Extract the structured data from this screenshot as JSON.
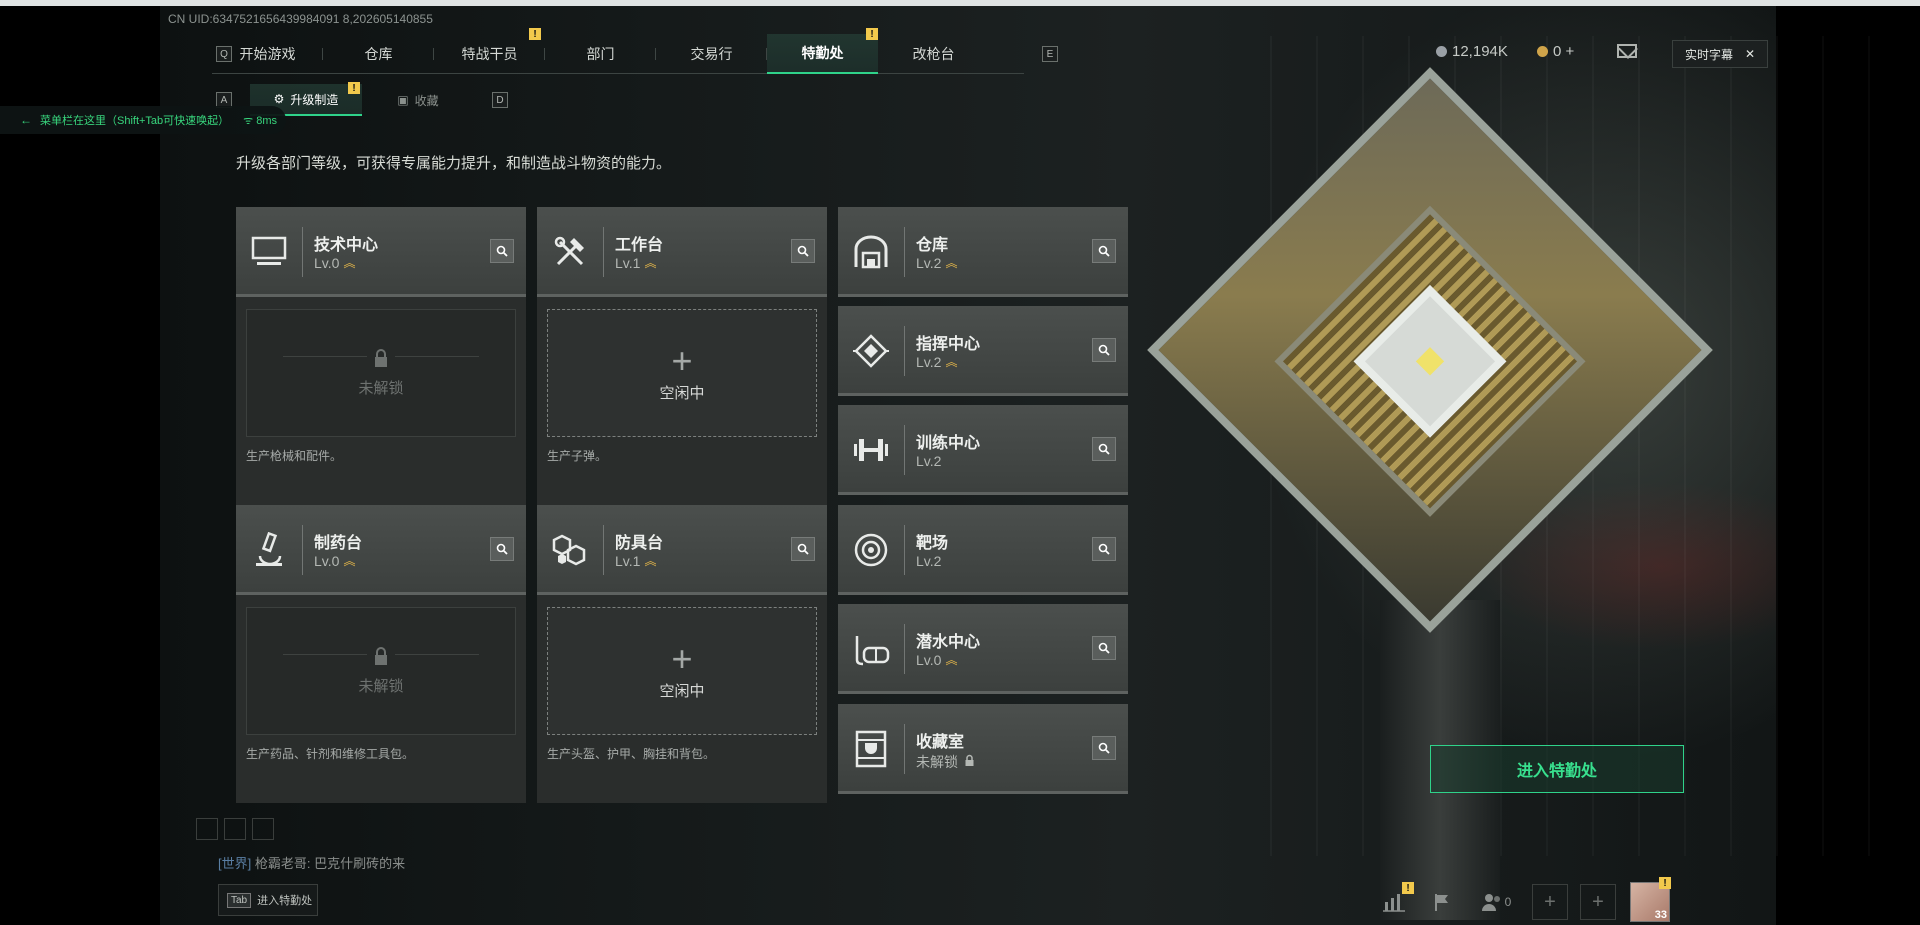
{
  "uid_text": "CN UID:6347521656439984091 8,202605140855",
  "top_nav": {
    "key_left": "Q",
    "key_right": "E",
    "tabs": [
      {
        "label": "开始游戏"
      },
      {
        "label": "仓库"
      },
      {
        "label": "特战干员",
        "badge": "!"
      },
      {
        "label": "部门"
      },
      {
        "label": "交易行"
      },
      {
        "label": "特勤处",
        "badge": "!",
        "active": true
      },
      {
        "label": "改枪台"
      }
    ]
  },
  "sub_nav": {
    "key_left": "A",
    "key_right": "D",
    "tabs": [
      {
        "label": "升级制造",
        "badge": "!",
        "active": true
      },
      {
        "label": "收藏"
      }
    ]
  },
  "overlay_notice": {
    "text": "菜单栏在这里（Shift+Tab可快速唤起）",
    "ping": "8ms"
  },
  "description": "升级各部门等级，可获得专属能力提升，和制造战斗物资的能力。",
  "currency": {
    "primary": "12,194K",
    "secondary": "0 +"
  },
  "caption_button": {
    "label": "实时字幕",
    "close": "✕"
  },
  "production_cards": [
    {
      "name": "技术中心",
      "level": "Lv.0",
      "icon": "monitor-icon",
      "slot_state": "locked",
      "slot_text": "未解锁",
      "subtitle": "生产枪械和配件。"
    },
    {
      "name": "工作台",
      "level": "Lv.1",
      "icon": "tools-icon",
      "slot_state": "idle",
      "slot_text": "空闲中",
      "subtitle": "生产子弹。"
    },
    {
      "name": "制药台",
      "level": "Lv.0",
      "icon": "microscope-icon",
      "slot_state": "locked",
      "slot_text": "未解锁",
      "subtitle": "生产药品、针剂和维修工具包。"
    },
    {
      "name": "防具台",
      "level": "Lv.1",
      "icon": "armor-icon",
      "slot_state": "idle",
      "slot_text": "空闲中",
      "subtitle": "生产头盔、护甲、胸挂和背包。"
    }
  ],
  "department_cards": [
    {
      "name": "仓库",
      "level": "Lv.2",
      "icon": "warehouse-icon",
      "upgradable": true
    },
    {
      "name": "指挥中心",
      "level": "Lv.2",
      "icon": "command-icon",
      "upgradable": true
    },
    {
      "name": "训练中心",
      "level": "Lv.2",
      "icon": "dumbbell-icon",
      "upgradable": false
    },
    {
      "name": "靶场",
      "level": "Lv.2",
      "icon": "target-icon",
      "upgradable": false
    },
    {
      "name": "潜水中心",
      "level": "Lv.0",
      "icon": "diving-icon",
      "upgradable": true
    },
    {
      "name": "收藏室",
      "level": "未解锁",
      "icon": "trophy-icon",
      "upgradable": false,
      "locked": true
    }
  ],
  "enter_button": "进入特勤处",
  "chat": {
    "channel": "[世界]",
    "message": "枪霸老哥: 巴克什刷砖的来"
  },
  "tab_hint": {
    "key": "Tab",
    "label": "进入特勤处"
  },
  "bottom_bar": {
    "friends_count": "0",
    "avatar_level": "33"
  },
  "colors": {
    "accent_green": "#2fd38a",
    "badge_yellow": "#f2c94c",
    "level_chevron": "#e6b84a"
  }
}
